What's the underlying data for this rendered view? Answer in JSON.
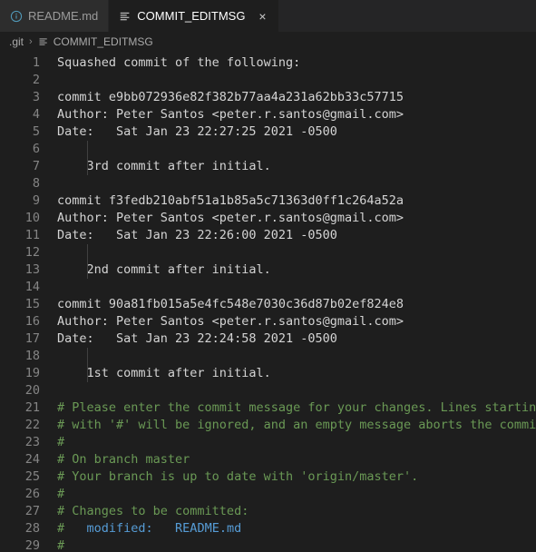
{
  "tabs": [
    {
      "label": "README.md",
      "icon": "markdown-info-icon",
      "active": false,
      "closable": false
    },
    {
      "label": "COMMIT_EDITMSG",
      "icon": "text-file-icon",
      "active": true,
      "closable": true,
      "close_label": "×"
    }
  ],
  "breadcrumb": {
    "root": ".git",
    "separator": "›",
    "file": "COMMIT_EDITMSG",
    "file_icon": "text-file-icon"
  },
  "colors": {
    "editor_background": "#1e1e1e",
    "tabbar_background": "#252526",
    "inactive_tab_background": "#2d2d2d",
    "line_number": "#858585",
    "foreground": "#d4d4d4",
    "comment": "#6a9955",
    "string_blue": "#569cd6",
    "markdown_icon": "#519aba"
  },
  "editor": {
    "first_line_number": 1,
    "last_line_number": 29,
    "lines": [
      {
        "n": 1,
        "tokens": [
          {
            "t": "Squashed commit of the following:",
            "c": "plain"
          }
        ]
      },
      {
        "n": 2,
        "tokens": []
      },
      {
        "n": 3,
        "tokens": [
          {
            "t": "commit e9bb072936e82f382b77aa4a231a62bb33c57715",
            "c": "plain"
          }
        ]
      },
      {
        "n": 4,
        "tokens": [
          {
            "t": "Author: Peter Santos <peter.r.santos@gmail.com>",
            "c": "plain"
          }
        ]
      },
      {
        "n": 5,
        "tokens": [
          {
            "t": "Date:   Sat Jan 23 22:27:25 2021 -0500",
            "c": "plain"
          }
        ]
      },
      {
        "n": 6,
        "tokens": []
      },
      {
        "n": 7,
        "tokens": [
          {
            "t": "    3rd commit after initial.",
            "c": "plain"
          }
        ]
      },
      {
        "n": 8,
        "tokens": []
      },
      {
        "n": 9,
        "tokens": [
          {
            "t": "commit f3fedb210abf51a1b85a5c71363d0ff1c264a52a",
            "c": "plain"
          }
        ]
      },
      {
        "n": 10,
        "tokens": [
          {
            "t": "Author: Peter Santos <peter.r.santos@gmail.com>",
            "c": "plain"
          }
        ]
      },
      {
        "n": 11,
        "tokens": [
          {
            "t": "Date:   Sat Jan 23 22:26:00 2021 -0500",
            "c": "plain"
          }
        ]
      },
      {
        "n": 12,
        "tokens": []
      },
      {
        "n": 13,
        "tokens": [
          {
            "t": "    2nd commit after initial.",
            "c": "plain"
          }
        ]
      },
      {
        "n": 14,
        "tokens": []
      },
      {
        "n": 15,
        "tokens": [
          {
            "t": "commit 90a81fb015a5e4fc548e7030c36d87b02ef824e8",
            "c": "plain"
          }
        ]
      },
      {
        "n": 16,
        "tokens": [
          {
            "t": "Author: Peter Santos <peter.r.santos@gmail.com>",
            "c": "plain"
          }
        ]
      },
      {
        "n": 17,
        "tokens": [
          {
            "t": "Date:   Sat Jan 23 22:24:58 2021 -0500",
            "c": "plain"
          }
        ]
      },
      {
        "n": 18,
        "tokens": []
      },
      {
        "n": 19,
        "tokens": [
          {
            "t": "    1st commit after initial.",
            "c": "plain"
          }
        ]
      },
      {
        "n": 20,
        "tokens": []
      },
      {
        "n": 21,
        "tokens": [
          {
            "t": "# Please enter the commit message for your changes. Lines starting",
            "c": "comment"
          }
        ]
      },
      {
        "n": 22,
        "tokens": [
          {
            "t": "# with '#' will be ignored, and an empty message aborts the commit.",
            "c": "comment"
          }
        ]
      },
      {
        "n": 23,
        "tokens": [
          {
            "t": "#",
            "c": "comment"
          }
        ]
      },
      {
        "n": 24,
        "tokens": [
          {
            "t": "# On branch master",
            "c": "comment"
          }
        ]
      },
      {
        "n": 25,
        "tokens": [
          {
            "t": "# Your branch is up to date with 'origin/master'.",
            "c": "comment"
          }
        ]
      },
      {
        "n": 26,
        "tokens": [
          {
            "t": "#",
            "c": "comment"
          }
        ]
      },
      {
        "n": 27,
        "tokens": [
          {
            "t": "# Changes to be committed:",
            "c": "comment"
          }
        ]
      },
      {
        "n": 28,
        "tokens": [
          {
            "t": "#",
            "c": "comment"
          },
          {
            "t": "   modified:   README.md",
            "c": "blue"
          }
        ]
      },
      {
        "n": 29,
        "tokens": [
          {
            "t": "#",
            "c": "comment"
          }
        ]
      }
    ]
  }
}
